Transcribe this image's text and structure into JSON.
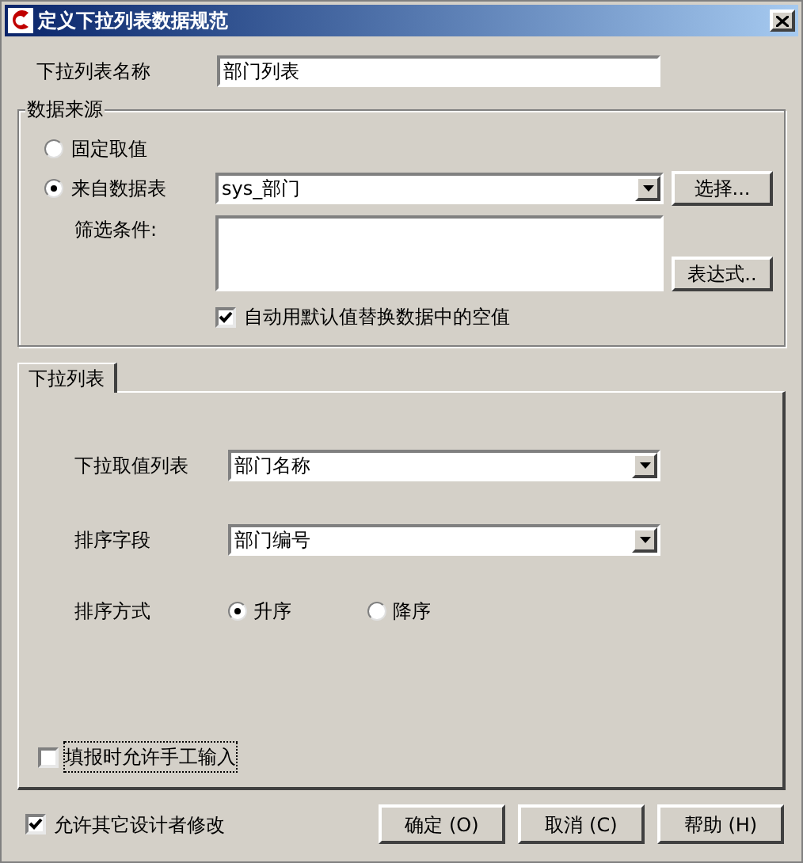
{
  "window": {
    "title": "定义下拉列表数据规范"
  },
  "list_name": {
    "label": "下拉列表名称",
    "value": "部门列表"
  },
  "data_source": {
    "title": "数据来源",
    "options": [
      {
        "label": "固定取值",
        "selected": false
      },
      {
        "label": "来自数据表",
        "selected": true
      }
    ],
    "table": {
      "value": "sys_部门"
    },
    "select_button": "选择...",
    "filter_label": "筛选条件:",
    "expression_button": "表达式..",
    "auto_default": {
      "label": "自动用默认值替换数据中的空值",
      "checked": true
    }
  },
  "tabs": [
    {
      "label": "下拉列表",
      "selected": true
    }
  ],
  "dropdown": {
    "value_list": {
      "label": "下拉取值列表",
      "value": "部门名称"
    },
    "sort_field": {
      "label": "排序字段",
      "value": "部门编号"
    },
    "sort_order": {
      "label": "排序方式",
      "options": [
        {
          "label": "升序",
          "selected": true
        },
        {
          "label": "降序",
          "selected": false
        }
      ]
    },
    "manual_input": {
      "label": "填报时允许手工输入",
      "checked": false
    }
  },
  "allow_modify": {
    "label": "允许其它设计者修改",
    "checked": true
  },
  "buttons": [
    "确定 (O)",
    "取消 (C)",
    "帮助 (H)"
  ]
}
